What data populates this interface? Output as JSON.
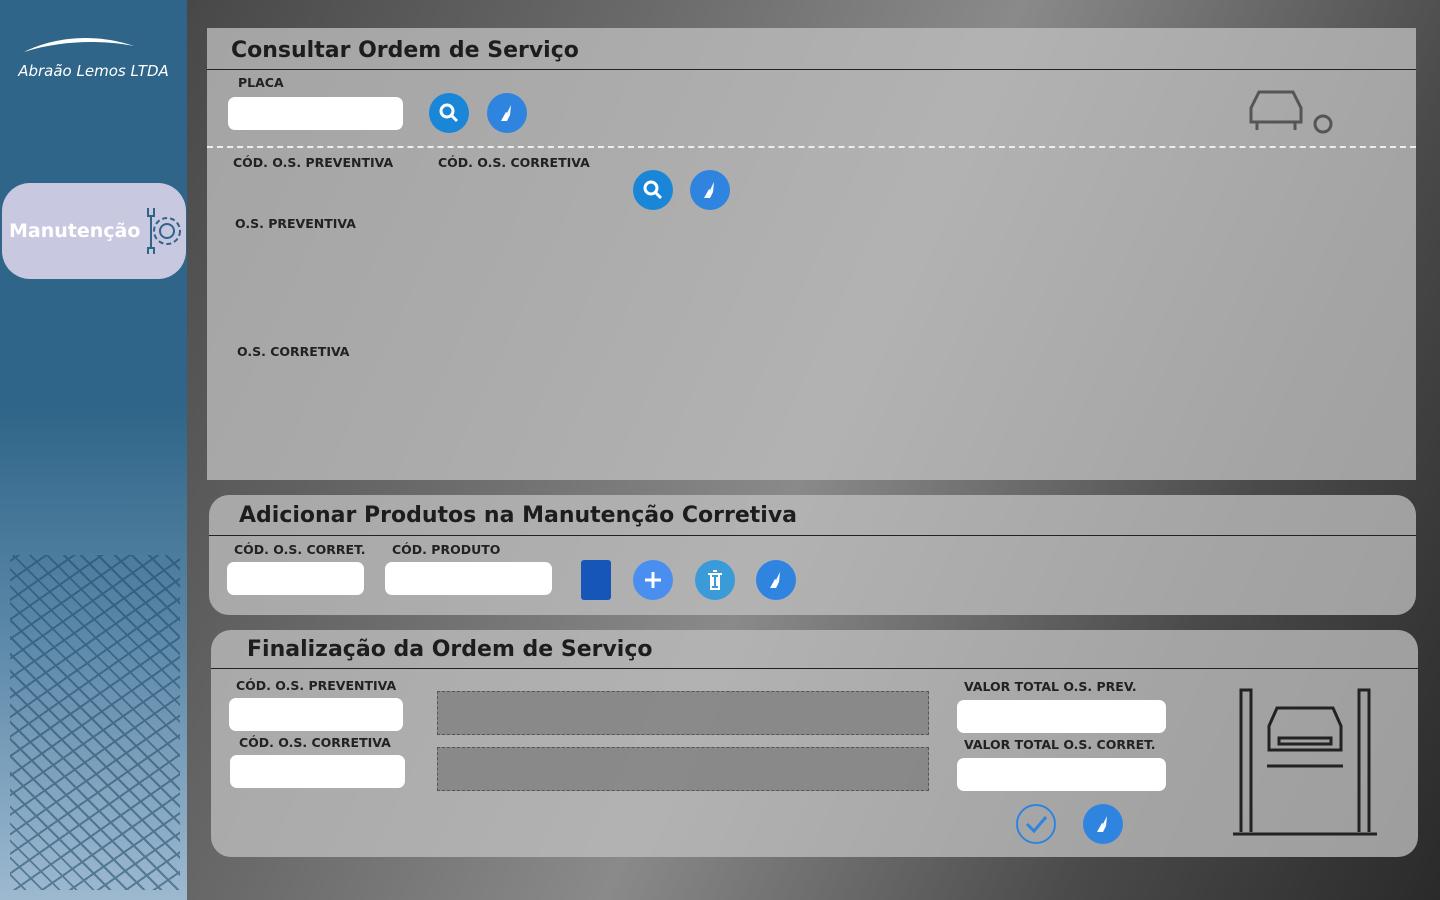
{
  "sidebar": {
    "brand": "Abraão Lemos LTDA",
    "nav_label": "Manutenção"
  },
  "consult": {
    "title": "Consultar Ordem de Serviço",
    "placa_label": "PLACA",
    "placa_value": "",
    "cod_prev_label": "CÓD. O.S. PREVENTIVA",
    "cod_corr_label": "CÓD. O.S. CORRETIVA",
    "os_prev_label": "O.S. PREVENTIVA",
    "os_corr_label": "O.S. CORRETIVA"
  },
  "add_products": {
    "title": "Adicionar Produtos na Manutenção Corretiva",
    "cod_os_label": "CÓD. O.S. CORRET.",
    "cod_prod_label": "CÓD. PRODUTO",
    "cod_os_value": "",
    "cod_prod_value": ""
  },
  "finalize": {
    "title": "Finalização da Ordem de Serviço",
    "cod_prev_label": "CÓD. O.S. PREVENTIVA",
    "cod_corr_label": "CÓD. O.S. CORRETIVA",
    "total_prev_label": "VALOR TOTAL O.S. PREV.",
    "total_corr_label": "VALOR TOTAL O.S. CORRET."
  },
  "colors": {
    "sidebar": "#2f6588",
    "nav": "#c8c8e0",
    "accent": "#2f84e0"
  }
}
